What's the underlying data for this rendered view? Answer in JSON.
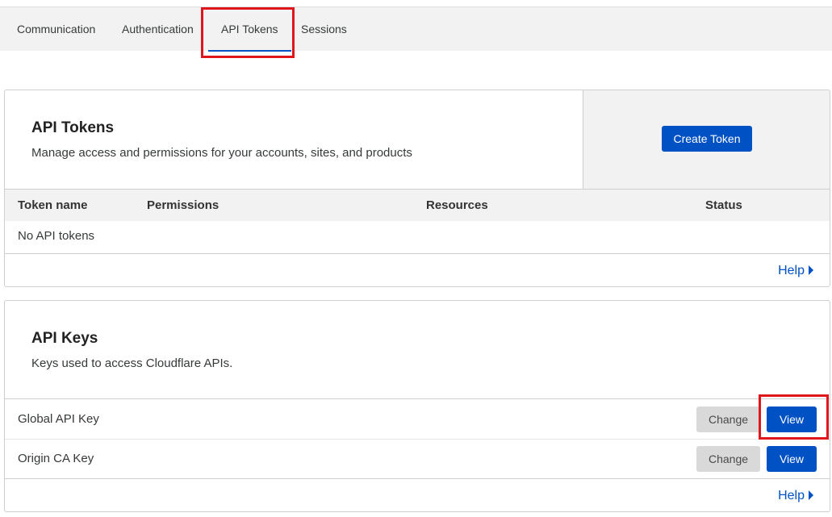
{
  "tabs": [
    {
      "label": "Communication"
    },
    {
      "label": "Authentication"
    },
    {
      "label": "API Tokens",
      "active": true
    },
    {
      "label": "Sessions"
    }
  ],
  "api_tokens": {
    "title": "API Tokens",
    "description": "Manage access and permissions for your accounts, sites, and products",
    "create_button": "Create Token",
    "columns": [
      "Token name",
      "Permissions",
      "Resources",
      "Status"
    ],
    "empty_text": "No API tokens",
    "help_label": "Help"
  },
  "api_keys": {
    "title": "API Keys",
    "description": "Keys used to access Cloudflare APIs.",
    "rows": [
      {
        "label": "Global API Key",
        "change_label": "Change",
        "view_label": "View"
      },
      {
        "label": "Origin CA Key",
        "change_label": "Change",
        "view_label": "View"
      }
    ],
    "help_label": "Help"
  },
  "colors": {
    "accent": "#0051c3",
    "highlight": "#e0161d",
    "tab_background": "#f2f2f2"
  }
}
